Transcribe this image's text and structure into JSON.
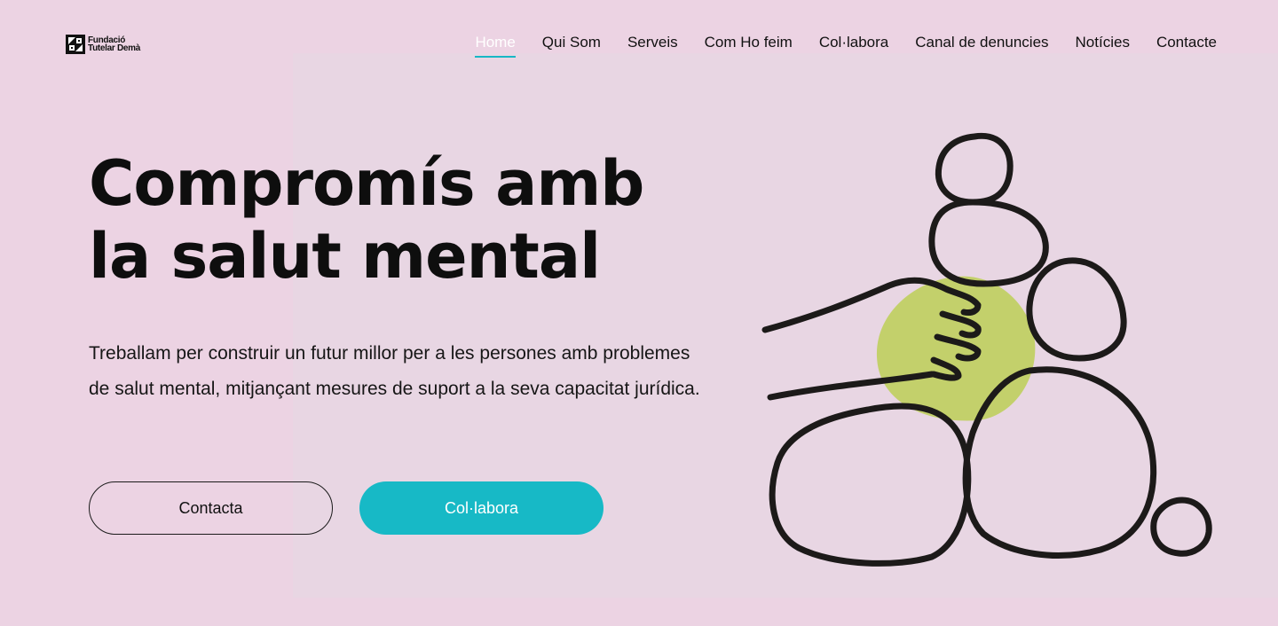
{
  "logo": {
    "line1": "Fundació",
    "line2": "Tutelar Demà"
  },
  "nav": {
    "items": [
      {
        "label": "Home",
        "active": true
      },
      {
        "label": "Qui Som"
      },
      {
        "label": "Serveis"
      },
      {
        "label": "Com Ho feim"
      },
      {
        "label": "Col·labora"
      },
      {
        "label": "Canal de denuncies"
      },
      {
        "label": "Notícies"
      },
      {
        "label": "Contacte"
      }
    ]
  },
  "hero": {
    "title": "Compromís amb la salut mental",
    "description": "Treballam per construir un futur millor per a les persones amb problemes de salut mental, mitjançant mesures de suport a la seva capacitat jurídica.",
    "contact_button": "Contacta",
    "collaborate_button": "Col·labora"
  },
  "colors": {
    "background": "#ecd3e3",
    "accent": "#17b9c6",
    "illustration_green": "#c3d06b",
    "text": "#111111"
  },
  "icons": {
    "logo": "logo-mark-icon",
    "illustration": "stacked-stones-hand-illustration"
  }
}
